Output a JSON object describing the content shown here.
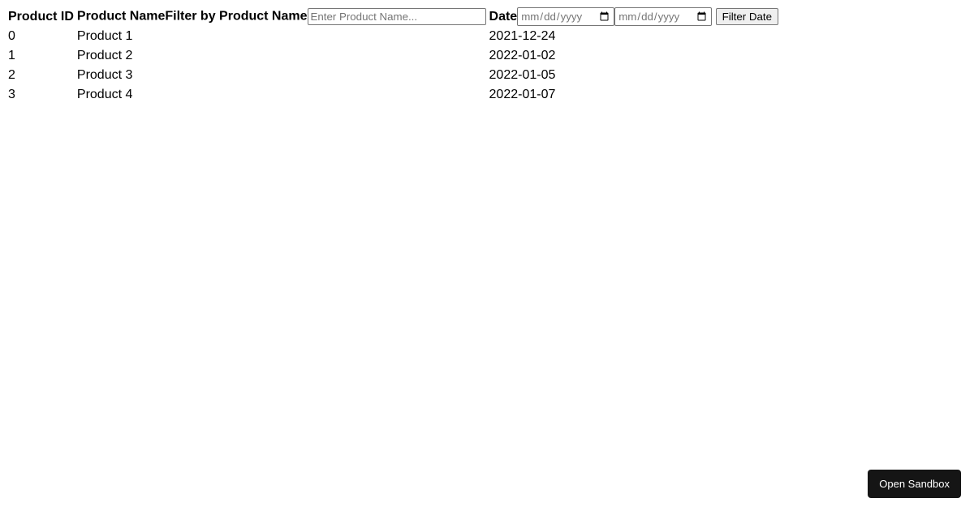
{
  "table": {
    "headers": {
      "product_id": "Product ID",
      "product_name": "Product Name",
      "filter_label": "Filter by Product Name",
      "filter_placeholder": "Enter Product Name...",
      "date": "Date",
      "date_placeholder": "mm/dd/yyyy",
      "filter_date_button": "Filter Date"
    },
    "rows": [
      {
        "id": "0",
        "name": "Product 1",
        "date": "2021-12-24"
      },
      {
        "id": "1",
        "name": "Product 2",
        "date": "2022-01-02"
      },
      {
        "id": "2",
        "name": "Product 3",
        "date": "2022-01-05"
      },
      {
        "id": "3",
        "name": "Product 4",
        "date": "2022-01-07"
      }
    ]
  },
  "sandbox_button": "Open Sandbox"
}
